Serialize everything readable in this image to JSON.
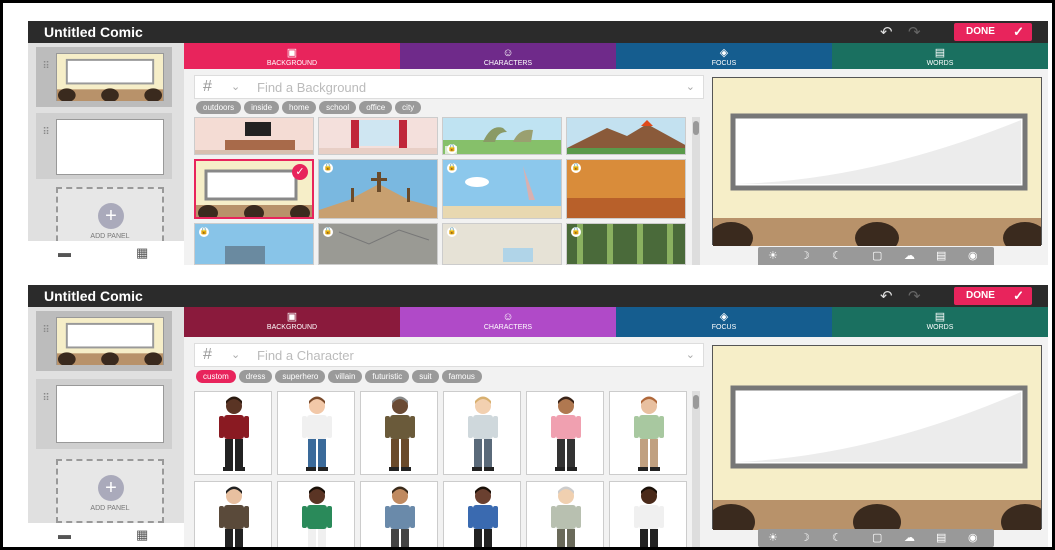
{
  "app": {
    "title": "Untitled Comic",
    "done_label": "DONE",
    "done_check": "✓",
    "undo_icon": "↶",
    "redo_icon": "↷",
    "add_panel_label": "ADD PANEL",
    "add_panel_plus": "+",
    "view_list_icon": "▬",
    "view_grid_icon": "▦",
    "panel_handle": "⠿",
    "accent": "#e8245c"
  },
  "tabs": [
    {
      "label": "BACKGROUND",
      "icon": "▣"
    },
    {
      "label": "CHARACTERS",
      "icon": "☺"
    },
    {
      "label": "FOCUS",
      "icon": "◈"
    },
    {
      "label": "WORDS",
      "icon": "▤"
    }
  ],
  "screenA": {
    "active_tab": "background",
    "search_prefix": "#",
    "search_placeholder": "Find a Background",
    "filters": [
      "outdoors",
      "inside",
      "home",
      "school",
      "office",
      "city"
    ]
  },
  "screenB": {
    "active_tab": "characters",
    "search_prefix": "#",
    "search_placeholder": "Find a Character",
    "filters": [
      "custom",
      "dress",
      "superhero",
      "villain",
      "futuristic",
      "suit",
      "famous"
    ],
    "active_filter": "custom"
  },
  "preview_tools": [
    "☀",
    "☽",
    "☾",
    "▢",
    "☁",
    "▤",
    "◉"
  ],
  "lock_icon": "🔒",
  "selected_check": "✓",
  "dropdown_icon": "⌄"
}
